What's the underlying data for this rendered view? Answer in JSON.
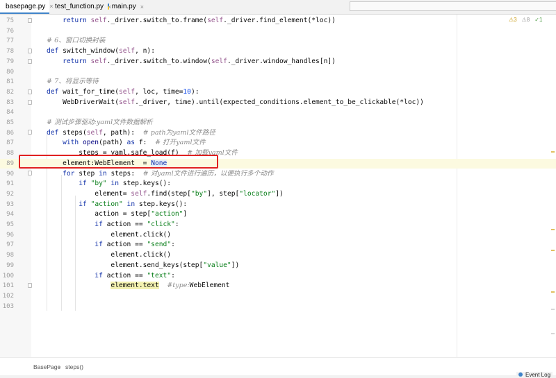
{
  "tabs": [
    {
      "label": "basepage.py",
      "active": true
    },
    {
      "label": "test_function.py",
      "active": false
    },
    {
      "label": "main.py",
      "active": false
    }
  ],
  "close_glyph": "×",
  "inspection": {
    "warnings": "3",
    "weak_warnings": "8",
    "typos": "1"
  },
  "breadcrumb": {
    "items": [
      "BasePage",
      "steps()"
    ],
    "separator": "›"
  },
  "status": {
    "event_log": "Event Log"
  },
  "editor": {
    "current_line": "89",
    "lines": [
      {
        "n": "75",
        "segs": []
      },
      {
        "n": "76",
        "segs": []
      },
      {
        "n": "77",
        "segs": []
      },
      {
        "n": "78",
        "segs": []
      },
      {
        "n": "79",
        "segs": []
      },
      {
        "n": "80",
        "segs": []
      },
      {
        "n": "81",
        "segs": []
      },
      {
        "n": "82",
        "segs": []
      },
      {
        "n": "83",
        "segs": []
      },
      {
        "n": "84",
        "segs": []
      },
      {
        "n": "85",
        "segs": []
      },
      {
        "n": "86",
        "segs": []
      },
      {
        "n": "87",
        "segs": []
      },
      {
        "n": "88",
        "segs": []
      },
      {
        "n": "89",
        "segs": []
      },
      {
        "n": "90",
        "segs": []
      },
      {
        "n": "91",
        "segs": []
      },
      {
        "n": "92",
        "segs": []
      },
      {
        "n": "93",
        "segs": []
      },
      {
        "n": "94",
        "segs": []
      },
      {
        "n": "95",
        "segs": []
      },
      {
        "n": "96",
        "segs": []
      },
      {
        "n": "97",
        "segs": []
      },
      {
        "n": "98",
        "segs": []
      },
      {
        "n": "99",
        "segs": []
      },
      {
        "n": "100",
        "segs": []
      },
      {
        "n": "101",
        "segs": []
      },
      {
        "n": "102",
        "segs": []
      },
      {
        "n": "103",
        "segs": []
      }
    ]
  }
}
